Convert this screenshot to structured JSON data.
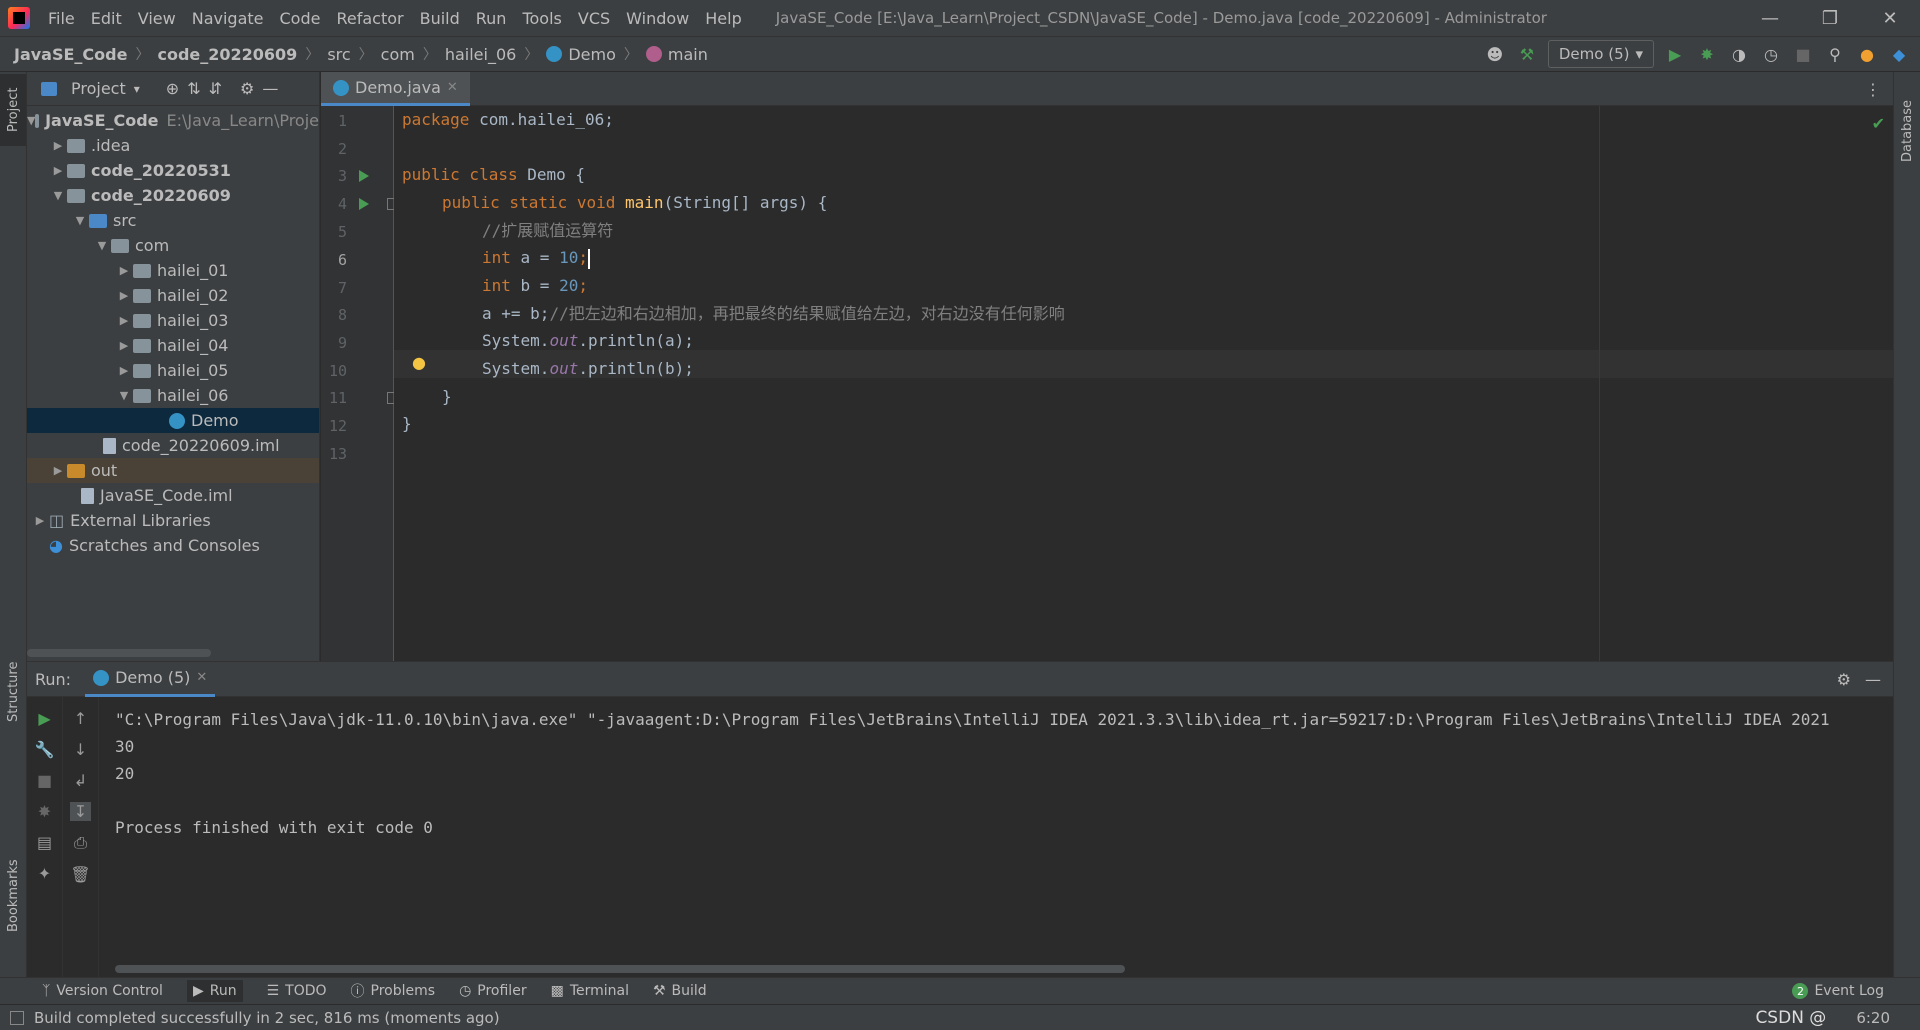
{
  "menubar": {
    "items": [
      "File",
      "Edit",
      "View",
      "Navigate",
      "Code",
      "Refactor",
      "Build",
      "Run",
      "Tools",
      "VCS",
      "Window",
      "Help"
    ],
    "title": "JavaSE_Code [E:\\Java_Learn\\Project_CSDN\\JavaSE_Code] - Demo.java [code_20220609] - Administrator"
  },
  "breadcrumb": [
    "JavaSE_Code",
    "code_20220609",
    "src",
    "com",
    "hailei_06",
    "Demo",
    "main"
  ],
  "toolbar": {
    "run_config": "Demo (5)"
  },
  "leftstripe": {
    "project": "Project",
    "structure": "Structure",
    "bookmarks": "Bookmarks"
  },
  "rightstripe": {
    "database": "Database"
  },
  "project": {
    "header": "Project",
    "tree": [
      {
        "label": "JavaSE_Code",
        "path": "E:\\Java_Learn\\Proje"
      },
      {
        "label": ".idea"
      },
      {
        "label": "code_20220531"
      },
      {
        "label": "code_20220609"
      },
      {
        "label": "src"
      },
      {
        "label": "com"
      },
      {
        "label": "hailei_01"
      },
      {
        "label": "hailei_02"
      },
      {
        "label": "hailei_03"
      },
      {
        "label": "hailei_04"
      },
      {
        "label": "hailei_05"
      },
      {
        "label": "hailei_06"
      },
      {
        "label": "Demo"
      },
      {
        "label": "code_20220609.iml"
      },
      {
        "label": "out"
      },
      {
        "label": "JavaSE_Code.iml"
      },
      {
        "label": "External Libraries"
      },
      {
        "label": "Scratches and Consoles"
      }
    ]
  },
  "editor": {
    "tab": "Demo.java",
    "line_numbers": [
      "1",
      "2",
      "3",
      "4",
      "5",
      "6",
      "7",
      "8",
      "9",
      "10",
      "11",
      "12",
      "13"
    ],
    "code": {
      "l1_kw": "package",
      "l1_rest": " com.hailei_06;",
      "l3_kw": "public class",
      "l3_rest": " Demo {",
      "l4_kw": "public static void",
      "l4_fn": " main",
      "l4_rest": "(String[] args) {",
      "l5_cm": "//扩展赋值运算符",
      "l6_kw": "int",
      "l6_var": " a = ",
      "l6_num": "10",
      "l6_end": ";",
      "l7_kw": "int",
      "l7_var": " b = ",
      "l7_num": "20",
      "l7_end": ";",
      "l8_code": "a += b;",
      "l8_cm": "//把左边和右边相加，再把最终的结果赋值给左边，对右边没有任何影响",
      "l9_a": "System.",
      "l9_out": "out",
      "l9_b": ".println(a);",
      "l10_a": "System.",
      "l10_out": "out",
      "l10_b": ".println(b);",
      "l11": "}",
      "l12": "}"
    }
  },
  "run": {
    "label": "Run:",
    "tab": "Demo (5)",
    "console": [
      "\"C:\\Program Files\\Java\\jdk-11.0.10\\bin\\java.exe\" \"-javaagent:D:\\Program Files\\JetBrains\\IntelliJ IDEA 2021.3.3\\lib\\idea_rt.jar=59217:D:\\Program Files\\JetBrains\\IntelliJ IDEA 2021",
      "30",
      "20",
      "",
      "Process finished with exit code 0"
    ]
  },
  "bottombar": [
    "Version Control",
    "Run",
    "TODO",
    "Problems",
    "Profiler",
    "Terminal",
    "Build"
  ],
  "eventlog": {
    "count": "2",
    "label": "Event Log"
  },
  "status": {
    "message": "Build completed successfully in 2 sec, 816 ms (moments ago)",
    "position": "6:20",
    "watermark": "CSDN @"
  }
}
